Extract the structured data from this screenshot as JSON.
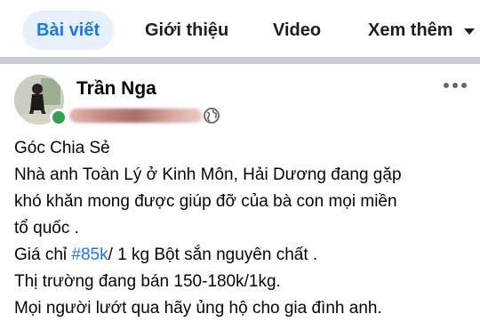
{
  "tabs": [
    {
      "label": "Bài viết",
      "active": true
    },
    {
      "label": "Giới thiệu",
      "active": false
    },
    {
      "label": "Video",
      "active": false
    },
    {
      "label": "Xem thêm",
      "active": false
    }
  ],
  "post": {
    "author": "Trần Nga",
    "audience_icon": "globe-icon",
    "menu_icon": "more-horizontal-icon",
    "lines": [
      "Góc Chia Sẻ",
      "Nhà anh Toàn Lý ở Kinh Môn, Hải Dương đang gặp",
      "khó khăn mong được giúp đỡ của bà con mọi miền",
      "tổ quốc .",
      {
        "before": "Giá chỉ ",
        "hashtag": "#85k",
        "after": "/ 1 kg Bột sắn nguyên chất ."
      },
      "Thị trường đang bán 150-180k/1kg.",
      "Mọi người lướt qua hãy ủng hộ  cho gia đình anh."
    ]
  },
  "colors": {
    "accent": "#1877f2",
    "active_tab_bg": "#e7f0fc",
    "online": "#31a24c",
    "divider": "#c9ccd1"
  }
}
